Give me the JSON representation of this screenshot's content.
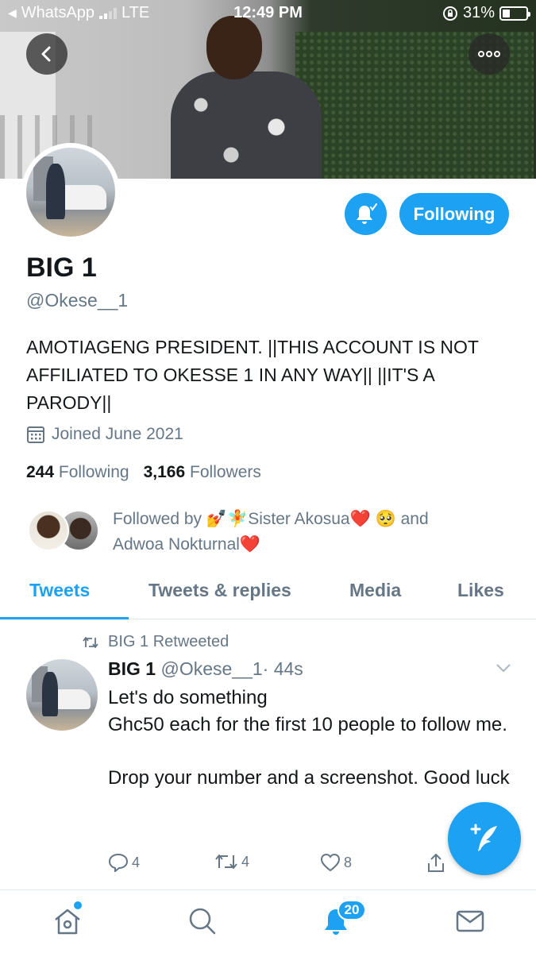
{
  "status_bar": {
    "back_app": "WhatsApp",
    "network": "LTE",
    "time": "12:49 PM",
    "battery": "31%",
    "battery_level": 0.31
  },
  "header": {
    "back_icon": "chevron-left-icon",
    "more_icon": "more-horizontal-icon"
  },
  "profile": {
    "name": "BIG 1",
    "handle": "@Okese__1",
    "bio": "AMOTIAGENG PRESIDENT. ||THIS ACCOUNT IS NOT AFFILIATED TO OKESSE 1 IN ANY WAY|| ||IT'S A PARODY||",
    "joined": "Joined June 2021",
    "following_count": "244",
    "following_label": "Following",
    "followers_count": "3,166",
    "followers_label": "Followers",
    "follow_button": "Following",
    "followed_by_prefix": "Followed by",
    "followed_by_user1": "💅🧚Sister Akosua",
    "followed_by_mid": "🥺 and",
    "followed_by_user2": "Adwoa Nokturnal",
    "heart": "❤️"
  },
  "tabs": [
    {
      "label": "Tweets",
      "active": true
    },
    {
      "label": "Tweets & replies",
      "active": false
    },
    {
      "label": "Media",
      "active": false
    },
    {
      "label": "Likes",
      "active": false
    }
  ],
  "tweet": {
    "retweeted_by": "BIG 1 Retweeted",
    "author_name": "BIG 1",
    "author_handle": "@Okese__1",
    "time": "· 44s",
    "body": "Let's do something\nGhc50 each for the first 10 people to follow me.\n\nDrop your number and a screenshot. Good luck",
    "replies": "4",
    "retweets": "4",
    "likes": "8"
  },
  "bottom_nav": {
    "notifications_badge": "20"
  },
  "colors": {
    "accent": "#1da1f2",
    "text": "#14171a",
    "muted": "#657786",
    "heart": "#e0245e"
  }
}
